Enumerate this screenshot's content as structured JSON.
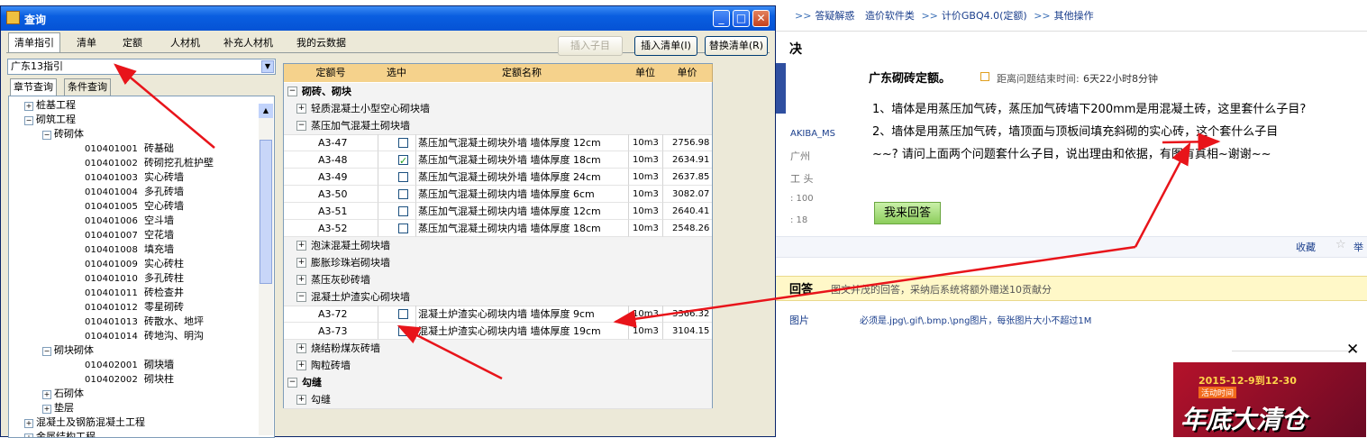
{
  "window": {
    "title": "查询"
  },
  "tabs": [
    {
      "label": "清单指引"
    },
    {
      "label": "清单"
    },
    {
      "label": "定额"
    },
    {
      "label": "人材机"
    },
    {
      "label": "补充人材机"
    },
    {
      "label": "我的云数据"
    }
  ],
  "buttons": {
    "insert_sub": "插入子目",
    "insert_list": "插入清单(I)",
    "replace_list": "替换清单(R)"
  },
  "combo": {
    "value": "广东13指引"
  },
  "subtabs": [
    {
      "label": "章节查询"
    },
    {
      "label": "条件查询"
    }
  ],
  "tree": [
    {
      "text": "桩基工程"
    },
    {
      "text": "砌筑工程"
    },
    {
      "text": "砖砌体"
    },
    {
      "code": "010401001",
      "name": "砖基础"
    },
    {
      "code": "010401002",
      "name": "砖砌挖孔桩护壁"
    },
    {
      "code": "010401003",
      "name": "实心砖墙"
    },
    {
      "code": "010401004",
      "name": "多孔砖墙"
    },
    {
      "code": "010401005",
      "name": "空心砖墙"
    },
    {
      "code": "010401006",
      "name": "空斗墙"
    },
    {
      "code": "010401007",
      "name": "空花墙"
    },
    {
      "code": "010401008",
      "name": "填充墙"
    },
    {
      "code": "010401009",
      "name": "实心砖柱"
    },
    {
      "code": "010401010",
      "name": "多孔砖柱"
    },
    {
      "code": "010401011",
      "name": "砖检查井"
    },
    {
      "code": "010401012",
      "name": "零星砌砖"
    },
    {
      "code": "010401013",
      "name": "砖散水、地坪"
    },
    {
      "code": "010401014",
      "name": "砖地沟、明沟"
    },
    {
      "text": "砌块砌体"
    },
    {
      "code": "010402001",
      "name": "砌块墙"
    },
    {
      "code": "010402002",
      "name": "砌块柱"
    },
    {
      "text": "石砌体"
    },
    {
      "text": "垫层"
    },
    {
      "text": "混凝土及钢筋混凝土工程"
    },
    {
      "text": "金属结构工程"
    }
  ],
  "grid": {
    "headers": [
      "定额号",
      "选中",
      "定额名称",
      "单位",
      "单价"
    ],
    "rows": [
      {
        "name": "砌砖、砌块"
      },
      {
        "name": "轻质混凝土小型空心砌块墙"
      },
      {
        "name": "蒸压加气混凝土砌块墙"
      },
      {
        "code": "A3-47",
        "name": "蒸压加气混凝土砌块外墙 墙体厚度 12cm",
        "unit": "10m3",
        "price": "2756.98"
      },
      {
        "code": "A3-48",
        "name": "蒸压加气混凝土砌块外墙 墙体厚度 18cm",
        "unit": "10m3",
        "price": "2634.91"
      },
      {
        "code": "A3-49",
        "name": "蒸压加气混凝土砌块外墙 墙体厚度 24cm",
        "unit": "10m3",
        "price": "2637.85"
      },
      {
        "code": "A3-50",
        "name": "蒸压加气混凝土砌块内墙 墙体厚度 6cm",
        "unit": "10m3",
        "price": "3082.07"
      },
      {
        "code": "A3-51",
        "name": "蒸压加气混凝土砌块内墙 墙体厚度 12cm",
        "unit": "10m3",
        "price": "2640.41"
      },
      {
        "code": "A3-52",
        "name": "蒸压加气混凝土砌块内墙 墙体厚度 18cm",
        "unit": "10m3",
        "price": "2548.26"
      },
      {
        "name": "泡沫混凝土砌块墙"
      },
      {
        "name": "膨胀珍珠岩砌块墙"
      },
      {
        "name": "蒸压灰砂砖墙"
      },
      {
        "name": "混凝土炉渣实心砌块墙"
      },
      {
        "code": "A3-72",
        "name": "混凝土炉渣实心砌块内墙 墙体厚度 9cm",
        "unit": "10m3",
        "price": "3366.32"
      },
      {
        "code": "A3-73",
        "name": "混凝土炉渣实心砌块内墙 墙体厚度 19cm",
        "unit": "10m3",
        "price": "3104.15"
      },
      {
        "name": "烧结粉煤灰砖墙"
      },
      {
        "name": "陶粒砖墙"
      },
      {
        "name": "勾缝"
      },
      {
        "name": "勾缝"
      }
    ]
  },
  "web": {
    "breadcrumb": [
      "答疑解惑",
      "造价软件类",
      "计价GBQ4.0(定额)",
      "其他操作"
    ],
    "section_char": "决",
    "question_title": "广东砌砖定额。",
    "timer_label": "距离问题结束时间:",
    "timer_value": "6天22小时8分钟",
    "q1": "1、墙体是用蒸压加气砖，蒸压加气砖墙下200mm是用混凝土砖，这里套什么子目?",
    "q2": "2、墙体是用蒸压加气砖，墙顶面与顶板间填充斜砌的实心砖，这个套什么子目",
    "q3": "~~?  请问上面两个问题套什么子目，说出理由和依据，有图有真相~谢谢~~",
    "user": "AKIBA_MS",
    "city": "广州",
    "side1": "工  头",
    "side2": ": 100",
    "side3": ": 18",
    "answer_button": "我来回答",
    "collect": "收藏",
    "report": "举",
    "answer_label": "回答",
    "answer_hint": "图文并茂的回答，采纳后系统将额外赠送10贡献分",
    "img_label": "图片",
    "img_hint": "必须是.jpg\\.gif\\.bmp.\\png图片，每张图片大小不超过1M",
    "ad_date": "2015-12-9到12-30",
    "ad_sub": "活动时间",
    "ad_title": "年底大清仓"
  },
  "colors": {
    "header": "#f5d28c",
    "titlebar": "#0a5ee0",
    "arrow": "#e8141a"
  }
}
